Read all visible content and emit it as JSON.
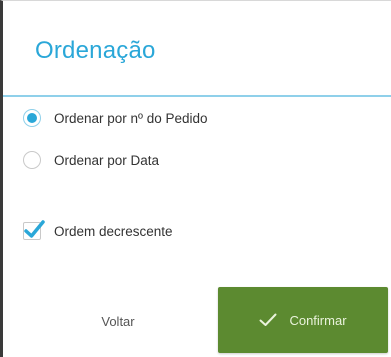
{
  "dialog": {
    "title": "Ordenação"
  },
  "options": {
    "by_order_number": {
      "label": "Ordenar por nº do Pedido",
      "selected": true
    },
    "by_date": {
      "label": "Ordenar por Data",
      "selected": false
    },
    "descending": {
      "label": "Ordem decrescente",
      "checked": true
    }
  },
  "buttons": {
    "back_label": "Voltar",
    "confirm_label": "Confirmar"
  },
  "colors": {
    "accent": "#2aa7d8",
    "confirm_bg": "#5c8a30",
    "divider": "#8fd0ea"
  },
  "icons": {
    "confirm": "check-icon",
    "descending": "checkmark-icon"
  }
}
